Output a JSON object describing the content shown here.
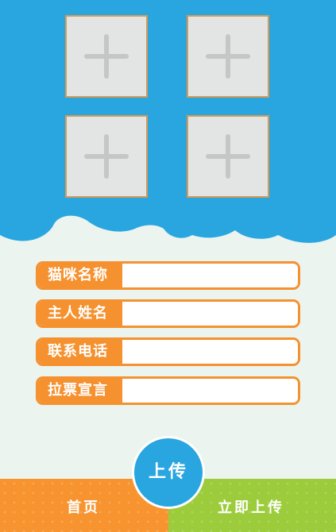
{
  "colors": {
    "header_blue": "#29A6E0",
    "accent_orange": "#F5912F",
    "accent_green": "#9CCC3C",
    "page_bg": "#EBF4EF"
  },
  "photos": {
    "slots": [
      {
        "icon": "plus-icon"
      },
      {
        "icon": "plus-icon"
      },
      {
        "icon": "plus-icon"
      },
      {
        "icon": "plus-icon"
      }
    ]
  },
  "form": {
    "fields": [
      {
        "label": "猫咪名称",
        "value": ""
      },
      {
        "label": "主人姓名",
        "value": ""
      },
      {
        "label": "联系电话",
        "value": ""
      },
      {
        "label": "拉票宣言",
        "value": ""
      }
    ]
  },
  "upload_button": {
    "label": "上传"
  },
  "bottom_nav": {
    "home_label": "首页",
    "upload_label": "立即上传"
  }
}
